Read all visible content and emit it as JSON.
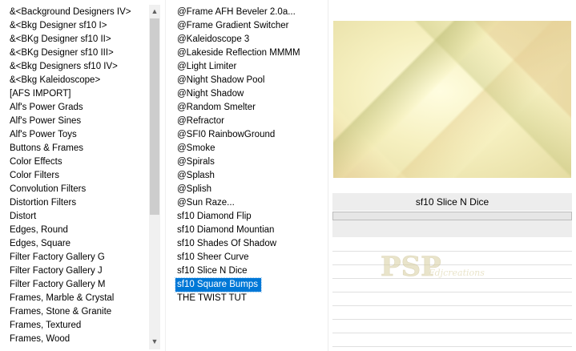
{
  "categories": {
    "items": [
      "&<Background Designers IV>",
      "&<Bkg Designer sf10 I>",
      "&<BKg Designer sf10 II>",
      "&<BKg Designer sf10 III>",
      "&<Bkg Designers sf10 IV>",
      "&<Bkg Kaleidoscope>",
      "[AFS IMPORT]",
      "Alf's Power Grads",
      "Alf's Power Sines",
      "Alf's Power Toys",
      "Buttons & Frames",
      "Color Effects",
      "Color Filters",
      "Convolution Filters",
      "Distortion Filters",
      "Distort",
      "Edges, Round",
      "Edges, Square",
      "Filter Factory Gallery G",
      "Filter Factory Gallery J",
      "Filter Factory Gallery M",
      "Frames, Marble & Crystal",
      "Frames, Stone & Granite",
      "Frames, Textured",
      "Frames, Wood"
    ]
  },
  "filters": {
    "selected_index": 20,
    "items": [
      "@Frame AFH Beveler 2.0a...",
      "@Frame Gradient Switcher",
      "@Kaleidoscope 3",
      "@Lakeside Reflection MMMM",
      "@Light Limiter",
      "@Night Shadow Pool",
      "@Night Shadow",
      "@Random Smelter",
      "@Refractor",
      "@SFI0 RainbowGround",
      "@Smoke",
      "@Spirals",
      "@Splash",
      "@Splish",
      "@Sun Raze...",
      "sf10 Diamond Flip",
      "sf10 Diamond Mountian",
      "sf10 Shades Of Shadow",
      "sf10 Sheer Curve",
      "sf10 Slice N Dice",
      "sf10 Square Bumps",
      "THE TWIST TUT"
    ]
  },
  "preview": {
    "filter_name": "sf10 Slice N Dice",
    "colors": {
      "light": "#fffde0",
      "mid": "#f6f0c0",
      "olive": "#c8c890",
      "tan": "#e6c896"
    }
  },
  "scrollbar": {
    "up_icon": "▲",
    "down_icon": "▼"
  },
  "watermark": {
    "text": "Fdjcreations",
    "logo_text": "PSP"
  },
  "colors": {
    "selection": "#0078d7"
  }
}
